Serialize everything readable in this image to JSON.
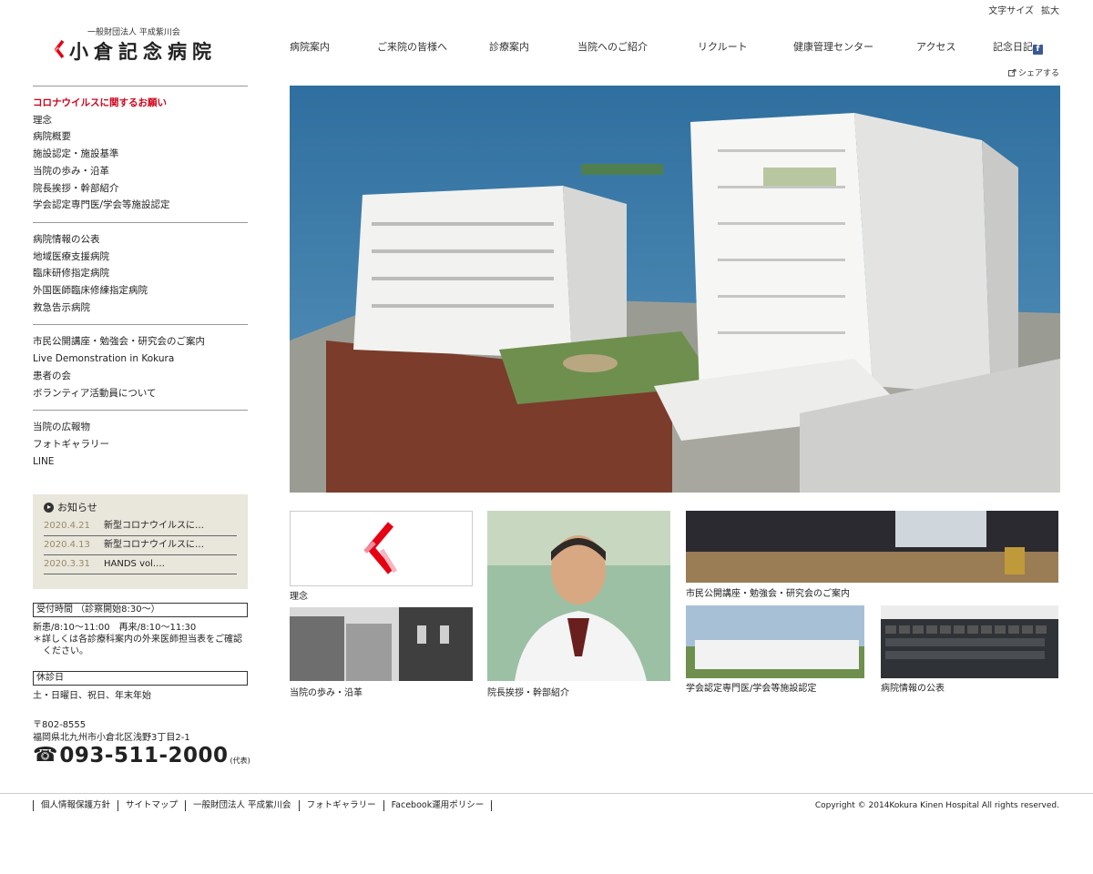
{
  "utility": {
    "font_size_label": "文字サイズ",
    "enlarge_label": "拡大",
    "share_label": "シェアする"
  },
  "logo": {
    "sub": "一般財団法人 平成紫川会",
    "name": "小倉記念病院"
  },
  "gnav": [
    {
      "label": "病院案内"
    },
    {
      "label": "ご来院の皆様へ"
    },
    {
      "label": "診療案内"
    },
    {
      "label": "当院へのご紹介"
    },
    {
      "label": "リクルート"
    },
    {
      "label": "健康管理センター"
    },
    {
      "label": "アクセス"
    },
    {
      "label": "記念日記"
    }
  ],
  "sidebar": {
    "group1": [
      "コロナウイルスに関するお願い",
      "理念",
      "病院概要",
      "施設認定・施設基準",
      "当院の歩み・沿革",
      "院長挨拶・幹部紹介",
      "学会認定専門医/学会等施設認定"
    ],
    "group2": [
      "病院情報の公表",
      "地域医療支援病院",
      "臨床研修指定病院",
      "外国医師臨床修練指定病院",
      "救急告示病院"
    ],
    "group3": [
      "市民公開講座・勉強会・研究会のご案内",
      "Live Demonstration in Kokura",
      "患者の会",
      "ボランティア活動員について"
    ],
    "group4": [
      "当院の広報物",
      "フォトギャラリー",
      "LINE"
    ]
  },
  "news": {
    "title": "お知らせ",
    "items": [
      {
        "date": "2020.4.21",
        "text": "新型コロナウイルスに…"
      },
      {
        "date": "2020.4.13",
        "text": "新型コロナウイルスに…"
      },
      {
        "date": "2020.3.31",
        "text": "HANDS vol.…"
      }
    ]
  },
  "hours": {
    "reception_title": "受付時間 （診察開始8:30～）",
    "reception_line1": "新患/8:10～11:00　再来/8:10～11:30",
    "reception_note": "＊詳しくは各診療科案内の外来医師担当表をご確認",
    "reception_note2": "ください。",
    "closed_title": "休診日",
    "closed_text": "土・日曜日、祝日、年末年始"
  },
  "contact": {
    "postal": "〒802-8555",
    "address": "福岡県北九州市小倉北区浅野3丁目2-1",
    "phone_icon": "☎",
    "phone": "093-511-2000",
    "phone_note": "(代表)"
  },
  "thumbs": {
    "rinen": "理念",
    "history": "当院の歩み・沿革",
    "director": "院長挨拶・幹部紹介",
    "lecture": "市民公開講座・勉強会・研究会のご案内",
    "specialists": "学会認定専門医/学会等施設認定",
    "info": "病院情報の公表"
  },
  "footer": {
    "links": [
      "個人情報保護方針",
      "サイトマップ",
      "一般財団法人 平成紫川会",
      "フォトギャラリー",
      "Facebook運用ポリシー"
    ],
    "copyright": "Copyright © 2014Kokura Kinen Hospital All rights reserved."
  },
  "colors": {
    "alert_red": "#d0021b",
    "news_bg": "#e9e6dc",
    "news_date": "#998a65",
    "logo_red": "#e60012"
  }
}
